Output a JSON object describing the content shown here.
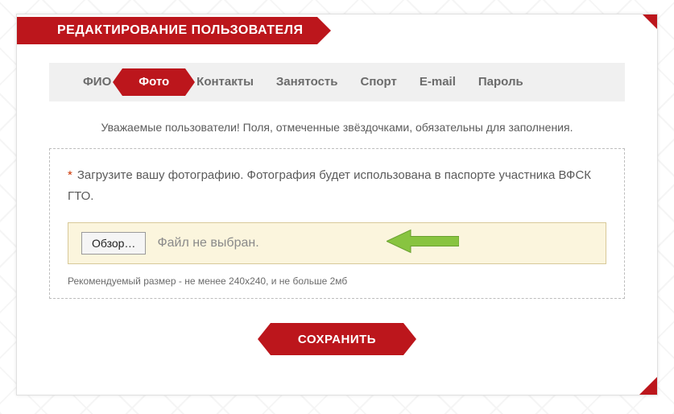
{
  "header": {
    "title": "РЕДАКТИРОВАНИЕ ПОЛЬЗОВАТЕЛЯ"
  },
  "tabs": [
    {
      "label": "ФИО",
      "active": false
    },
    {
      "label": "Фото",
      "active": true
    },
    {
      "label": "Контакты",
      "active": false
    },
    {
      "label": "Занятость",
      "active": false
    },
    {
      "label": "Спорт",
      "active": false
    },
    {
      "label": "E-mail",
      "active": false
    },
    {
      "label": "Пароль",
      "active": false
    }
  ],
  "notice": "Уважаемые пользователи! Поля, отмеченные звёздочками, обязательны для заполнения.",
  "form": {
    "asterisk": "*",
    "instruction": "Загрузите вашу фотографию. Фотография будет использована в паспорте участника ВФСК ГТО.",
    "browse_label": "Обзор…",
    "file_status": "Файл не выбран.",
    "hint": "Рекомендуемый размер - не менее 240x240, и не больше 2мб"
  },
  "save_label": "СОХРАНИТЬ"
}
